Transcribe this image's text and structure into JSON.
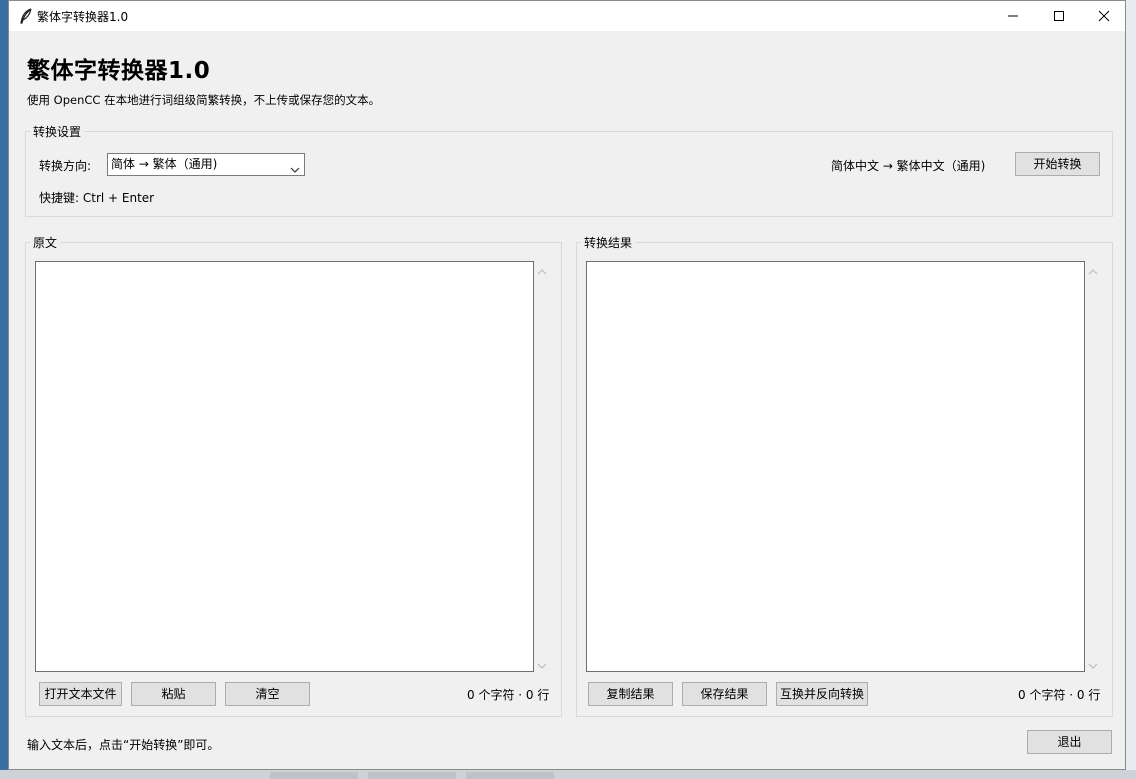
{
  "window": {
    "title": "繁体字转换器1.0"
  },
  "header": {
    "title": "繁体字转换器1.0",
    "subtitle": "使用 OpenCC 在本地进行词组级简繁转换，不上传或保存您的文本。"
  },
  "settings": {
    "legend": "转换设置",
    "direction_label": "转换方向:",
    "direction_value": "简体 → 繁体（通用)",
    "direction_summary": "简体中文 → 繁体中文（通用)",
    "convert_button": "开始转换",
    "shortcut": "快捷键: Ctrl + Enter"
  },
  "source": {
    "legend": "原文",
    "text": "",
    "open_button": "打开文本文件",
    "paste_button": "粘贴",
    "clear_button": "清空",
    "count": "0 个字符 · 0 行"
  },
  "result": {
    "legend": "转换结果",
    "text": "",
    "copy_button": "复制结果",
    "save_button": "保存结果",
    "swap_button": "互换并反向转换",
    "count": "0 个字符 · 0 行"
  },
  "status": {
    "text": "输入文本后，点击“开始转换”即可。",
    "exit_button": "退出"
  }
}
